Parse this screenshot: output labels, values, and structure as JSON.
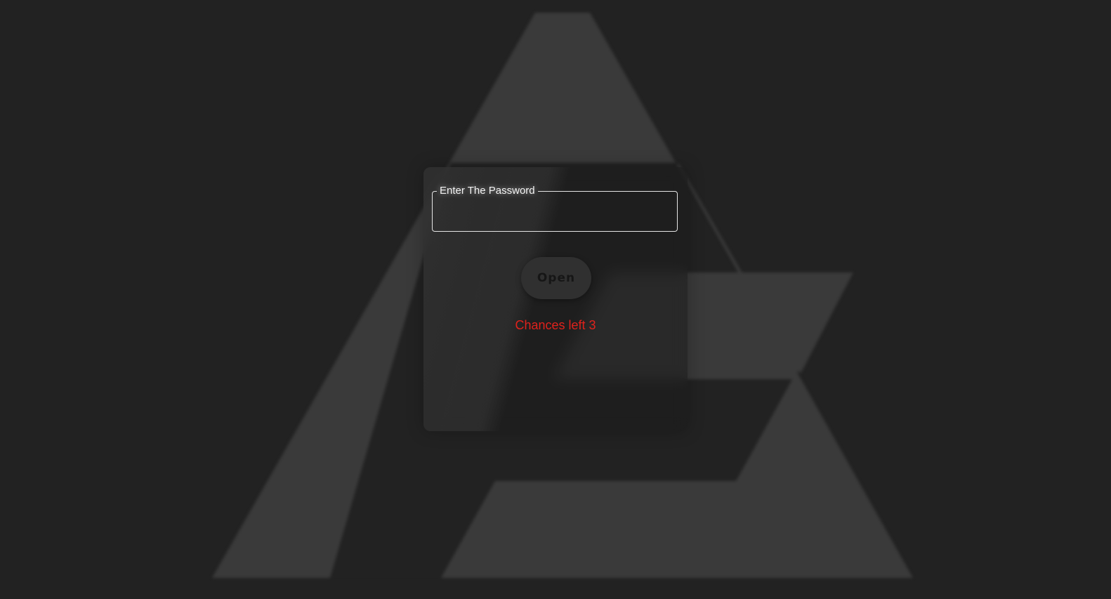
{
  "login": {
    "field_label": "Enter The Password",
    "password_value": "",
    "open_label": "Open",
    "chances_text": "Chances left 3"
  },
  "background": {
    "logo_icon": "triangle-logo-icon",
    "logo_color": "#3a3a3a",
    "page_color": "#222222"
  },
  "colors": {
    "warning": "#e0221c",
    "field_border": "#e6e6e6"
  }
}
